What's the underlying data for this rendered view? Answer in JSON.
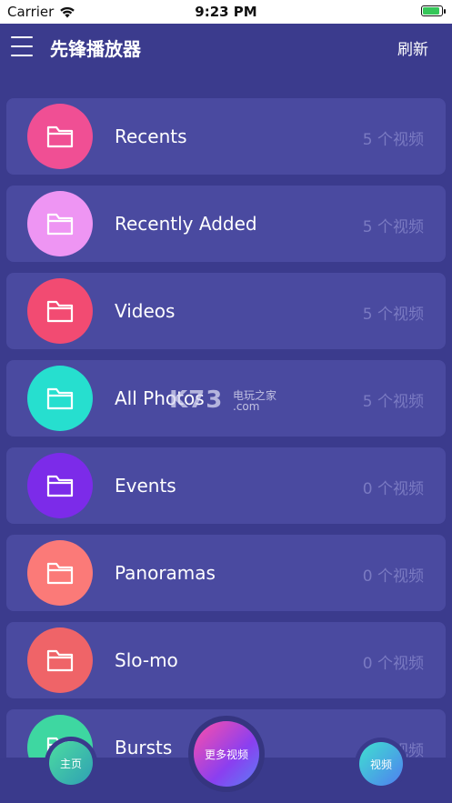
{
  "status_bar": {
    "carrier": "Carrier",
    "time": "9:23 PM"
  },
  "nav": {
    "title": "先锋播放器",
    "refresh_label": "刷新"
  },
  "albums": [
    {
      "title": "Recents",
      "count": "5 个视频",
      "color": "#f04f94"
    },
    {
      "title": "Recently Added",
      "count": "5 个视频",
      "color": "#ee95f3"
    },
    {
      "title": "Videos",
      "count": "5 个视频",
      "color": "#f24b72"
    },
    {
      "title": "All Photos",
      "count": "5 个视频",
      "color": "#26dfcf"
    },
    {
      "title": "Events",
      "count": "0 个视频",
      "color": "#7c2be9"
    },
    {
      "title": "Panoramas",
      "count": "0 个视频",
      "color": "#fb7a78"
    },
    {
      "title": "Slo-mo",
      "count": "0 个视频",
      "color": "#ef6468"
    },
    {
      "title": "Bursts",
      "count": "0 个视频",
      "color": "#3ed7a1"
    }
  ],
  "watermark": {
    "logo": "K73",
    "line1": "电玩之家",
    "line2": ".com"
  },
  "tab_bar": {
    "home_label": "主页",
    "more_label": "更多视频",
    "video_label": "视频"
  },
  "colors": {
    "background": "#3b3b8d",
    "card": "#4a4aa0",
    "count_text": "#7a7ac2"
  }
}
